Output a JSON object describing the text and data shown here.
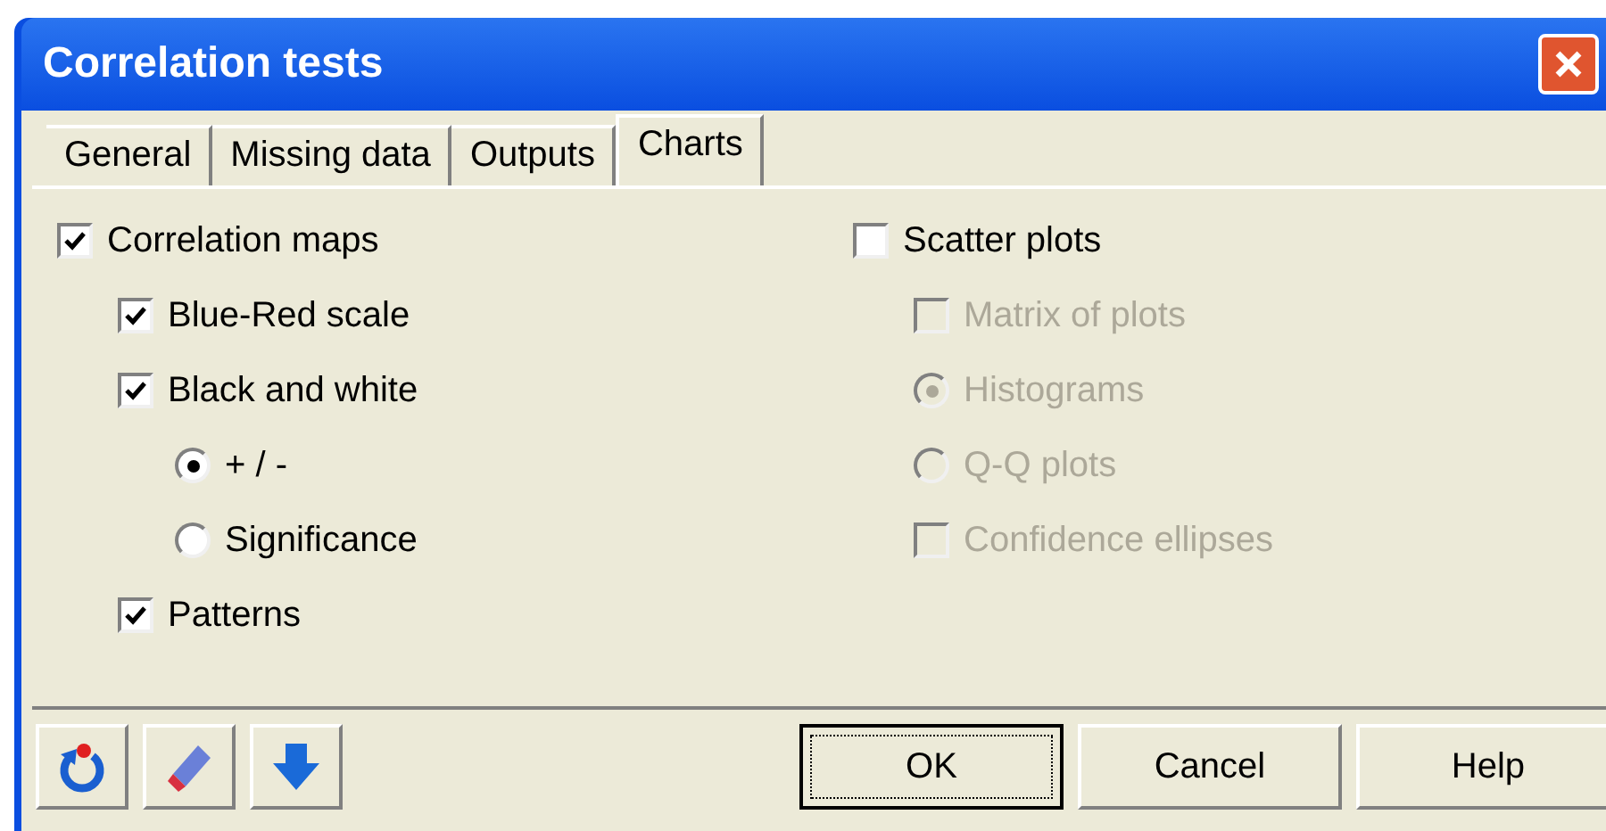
{
  "window": {
    "title": "Correlation tests"
  },
  "tabs": [
    {
      "label": "General",
      "selected": false
    },
    {
      "label": "Missing data",
      "selected": false
    },
    {
      "label": "Outputs",
      "selected": false
    },
    {
      "label": "Charts",
      "selected": true
    }
  ],
  "left_options": [
    {
      "kind": "checkbox",
      "label": "Correlation maps",
      "checked": true,
      "disabled": false,
      "children": [
        {
          "kind": "checkbox",
          "label": "Blue-Red scale",
          "checked": true,
          "disabled": false
        },
        {
          "kind": "checkbox",
          "label": "Black and white",
          "checked": true,
          "disabled": false,
          "children": [
            {
              "kind": "radio",
              "label": "+ / -",
              "selected": true,
              "disabled": false
            },
            {
              "kind": "radio",
              "label": "Significance",
              "selected": false,
              "disabled": false
            }
          ]
        },
        {
          "kind": "checkbox",
          "label": "Patterns",
          "checked": true,
          "disabled": false
        }
      ]
    }
  ],
  "right_options": [
    {
      "kind": "checkbox",
      "label": "Scatter plots",
      "checked": false,
      "disabled": false,
      "children": [
        {
          "kind": "checkbox",
          "label": "Matrix of plots",
          "checked": false,
          "disabled": true
        },
        {
          "kind": "radio",
          "label": "Histograms",
          "selected": true,
          "disabled": true
        },
        {
          "kind": "radio",
          "label": "Q-Q plots",
          "selected": false,
          "disabled": true
        },
        {
          "kind": "checkbox",
          "label": "Confidence ellipses",
          "checked": false,
          "disabled": true
        }
      ]
    }
  ],
  "buttons": [
    {
      "label": "OK",
      "default": true
    },
    {
      "label": "Cancel",
      "default": false
    },
    {
      "label": "Help",
      "default": false
    }
  ]
}
